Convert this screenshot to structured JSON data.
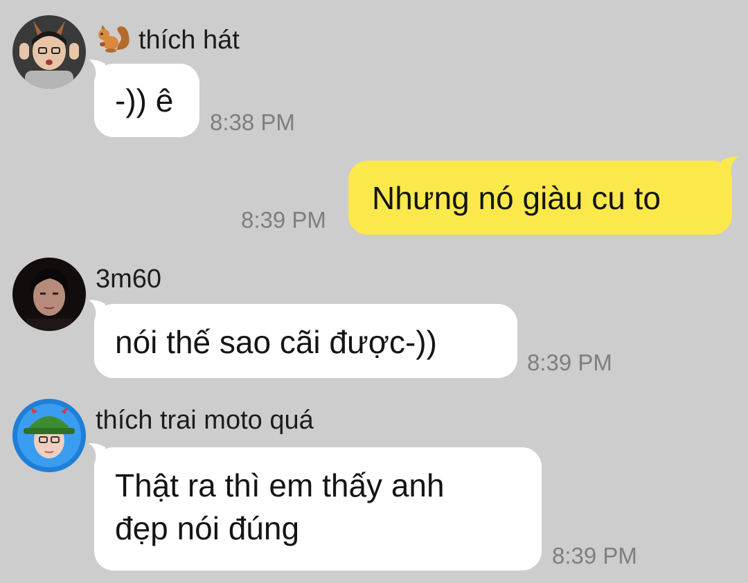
{
  "messages": [
    {
      "sender": "thích hát",
      "avatar": "avatar-boy-bunny-ears",
      "emoji": "squirrel-icon",
      "text": "-)) ê",
      "time": "8:38 PM",
      "mine": false
    },
    {
      "text": "Nhưng nó giàu cu to",
      "time": "8:39 PM",
      "mine": true
    },
    {
      "sender": "3m60",
      "avatar": "avatar-dark-portrait",
      "text": "nói thế sao cãi được-))",
      "time": "8:39 PM",
      "mine": false
    },
    {
      "sender": "thích trai moto quá",
      "avatar": "avatar-boy-green-hat",
      "text_line1": "Thật ra thì em thấy anh",
      "text_line2": "đẹp nói đúng",
      "time": "8:39 PM",
      "mine": false
    }
  ],
  "colors": {
    "background": "#cdcdcd",
    "bubble_incoming": "#ffffff",
    "bubble_outgoing": "#fbe94b",
    "timestamp": "#7e7e7e"
  }
}
